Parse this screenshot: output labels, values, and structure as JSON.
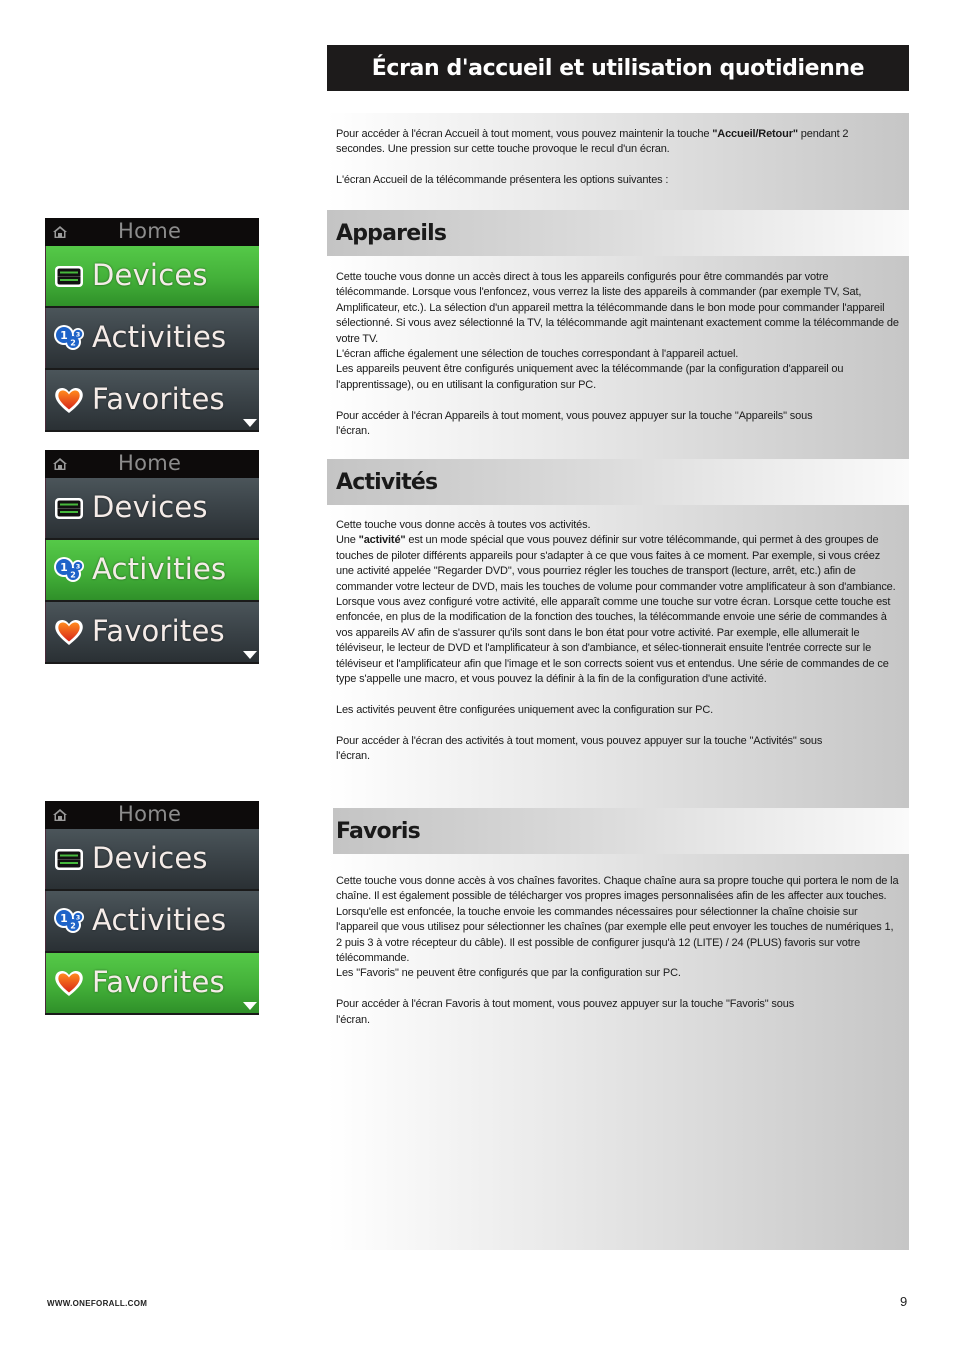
{
  "page": {
    "title": "Écran d'accueil et utilisation quotidienne",
    "footer_url": "WWW.ONEFORALL.COM",
    "page_number": "9"
  },
  "intro": {
    "p1_before": "Pour accéder à l'écran Accueil à tout moment, vous pouvez maintenir la touche ",
    "p1_bold": "\"Accueil/Retour\"",
    "p1_after": " pendant 2 secondes. Une pression sur cette touche provoque le recul d'un écran.",
    "p2": "L'écran Accueil de la télécommande présentera les options suivantes :"
  },
  "sections": {
    "appareils": {
      "heading": "Appareils",
      "p1": "Cette touche vous donne un accès direct à tous les appareils configurés pour être commandés par votre télécommande. Lorsque vous l'enfoncez, vous verrez la liste des appareils à commander (par exemple TV, Sat, Amplificateur, etc.). La sélection d'un appareil mettra la télécommande dans le bon mode pour commander l'appareil sélectionné. Si vous avez sélectionné la TV, la télécommande agit maintenant exactement comme la télécommande de votre TV.",
      "p1b": "L'écran affiche également une sélection de touches correspondant à l'appareil actuel.",
      "p1c": "Les appareils peuvent être configurés uniquement avec la télécommande (par la configuration d'appareil ou l'apprentissage), ou en utilisant la configuration sur PC.",
      "p2": "Pour accéder à l'écran Appareils à tout moment, vous pouvez appuyer sur la touche \"Appareils\" sous l'écran."
    },
    "activites": {
      "heading": "Activités",
      "p1": "Cette touche vous donne accès à toutes vos activités.",
      "p1b_before": "Une ",
      "p1b_bold": "\"activité\"",
      "p1b_after": " est un mode spécial que vous pouvez définir sur votre télécommande, qui permet à des groupes de touches de piloter différents appareils pour s'adapter à ce que vous faites à ce moment. Par exemple, si vous créez une activité appelée \"Regarder DVD\", vous pourriez régler les touches de transport (lecture, arrêt, etc.) afin de commander votre lecteur de DVD, mais les touches de volume pour commander votre amplificateur à son d'ambiance.",
      "p1c": "Lorsque vous avez configuré votre activité, elle apparaît comme une touche sur votre écran. Lorsque cette touche est enfoncée, en plus de la modification de la fonction des touches, la télécommande envoie une série de commandes à vos appareils AV afin de s'assurer qu'ils sont dans le bon état pour votre activité. Par exemple, elle allumerait le téléviseur, le lecteur de DVD et l'amplificateur à son d'ambiance, et sélec-tionnerait ensuite l'entrée correcte sur le téléviseur et l'amplificateur afin que l'image et le son corrects soient vus et entendus. Une série de commandes de ce type s'appelle une macro, et vous pouvez la définir à la fin de la configuration d'une activité.",
      "p2": "Les activités peuvent être configurées uniquement avec la configuration sur PC.",
      "p3": "Pour accéder à l'écran des activités à tout moment, vous pouvez appuyer sur la touche \"Activités\" sous l'écran."
    },
    "favoris": {
      "heading": "Favoris",
      "p1": "Cette touche vous donne accès à vos chaînes favorites. Chaque chaîne aura sa propre touche qui portera le nom de la chaîne. Il est également possible de télécharger vos propres images personnalisées afin de les affecter aux touches. Lorsqu'elle est enfoncée, la touche envoie les commandes nécessaires pour sélectionner la chaîne choisie sur l'appareil que vous utilisez pour sélectionner les chaînes (par exemple elle peut envoyer les touches de numériques 1, 2 puis 3 à votre récepteur du câble). Il est possible de configurer jusqu'à 12 (LITE) / 24 (PLUS) favoris sur votre télécommande.",
      "p1b": "Les \"Favoris\" ne peuvent être configurés que par la configuration sur PC.",
      "p2": "Pour accéder à l'écran Favoris à tout moment, vous pouvez appuyer sur la touche \"Favoris\" sous l'écran."
    }
  },
  "screens": [
    {
      "title": "Home",
      "home_icon": "home-icon",
      "scroll_icon": "triangle-down-icon",
      "items": [
        {
          "label": "Devices",
          "icon": "devices-icon",
          "selected": true
        },
        {
          "label": "Activities",
          "icon": "activities-icon",
          "selected": false
        },
        {
          "label": "Favorites",
          "icon": "heart-icon",
          "selected": false
        }
      ]
    },
    {
      "title": "Home",
      "home_icon": "home-icon",
      "scroll_icon": "triangle-down-icon",
      "items": [
        {
          "label": "Devices",
          "icon": "devices-icon",
          "selected": false
        },
        {
          "label": "Activities",
          "icon": "activities-icon",
          "selected": true
        },
        {
          "label": "Favorites",
          "icon": "heart-icon",
          "selected": false
        }
      ]
    },
    {
      "title": "Home",
      "home_icon": "home-icon",
      "scroll_icon": "triangle-down-icon",
      "items": [
        {
          "label": "Devices",
          "icon": "devices-icon",
          "selected": false
        },
        {
          "label": "Activities",
          "icon": "activities-icon",
          "selected": false
        },
        {
          "label": "Favorites",
          "icon": "heart-icon",
          "selected": true
        }
      ]
    }
  ],
  "colors": {
    "title_bar": "#1d1b1b",
    "selected_item": "#43b039",
    "unselected_item": "#3a4247",
    "screen_header": "#0d0b0b"
  }
}
